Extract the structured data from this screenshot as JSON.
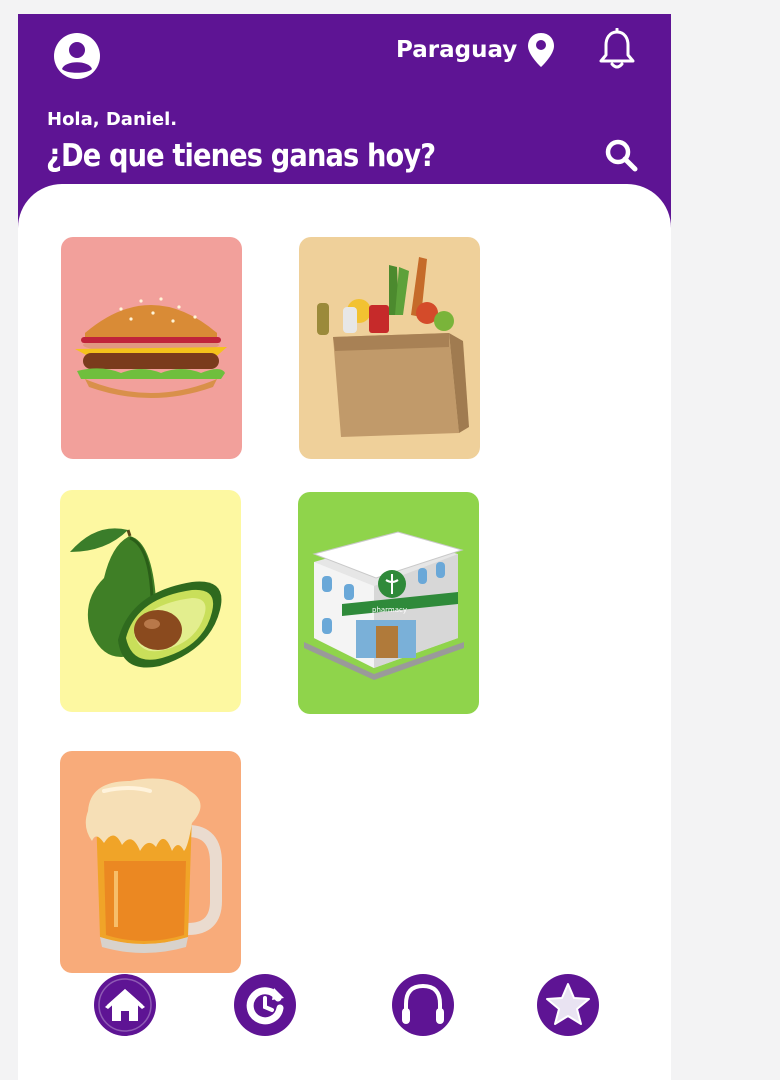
{
  "header": {
    "location": "Paraguay",
    "greeting": "Hola, Daniel.",
    "question": "¿De que tienes ganas hoy?"
  },
  "categories": [
    {
      "name": "burger",
      "color": "#f2a09b"
    },
    {
      "name": "grocery-bag",
      "color": "#efd09a"
    },
    {
      "name": "avocado",
      "color": "#fdf8a1"
    },
    {
      "name": "pharmacy",
      "color": "#8fd44b",
      "sign_text": "pharmacy"
    },
    {
      "name": "beer",
      "color": "#f8ab7a"
    }
  ],
  "nav": {
    "items": [
      "home-icon",
      "history-icon",
      "headset-icon",
      "star-icon"
    ]
  },
  "colors": {
    "brand_purple": "#5e1494",
    "background": "#f3f3f4",
    "card": "#ffffff"
  }
}
